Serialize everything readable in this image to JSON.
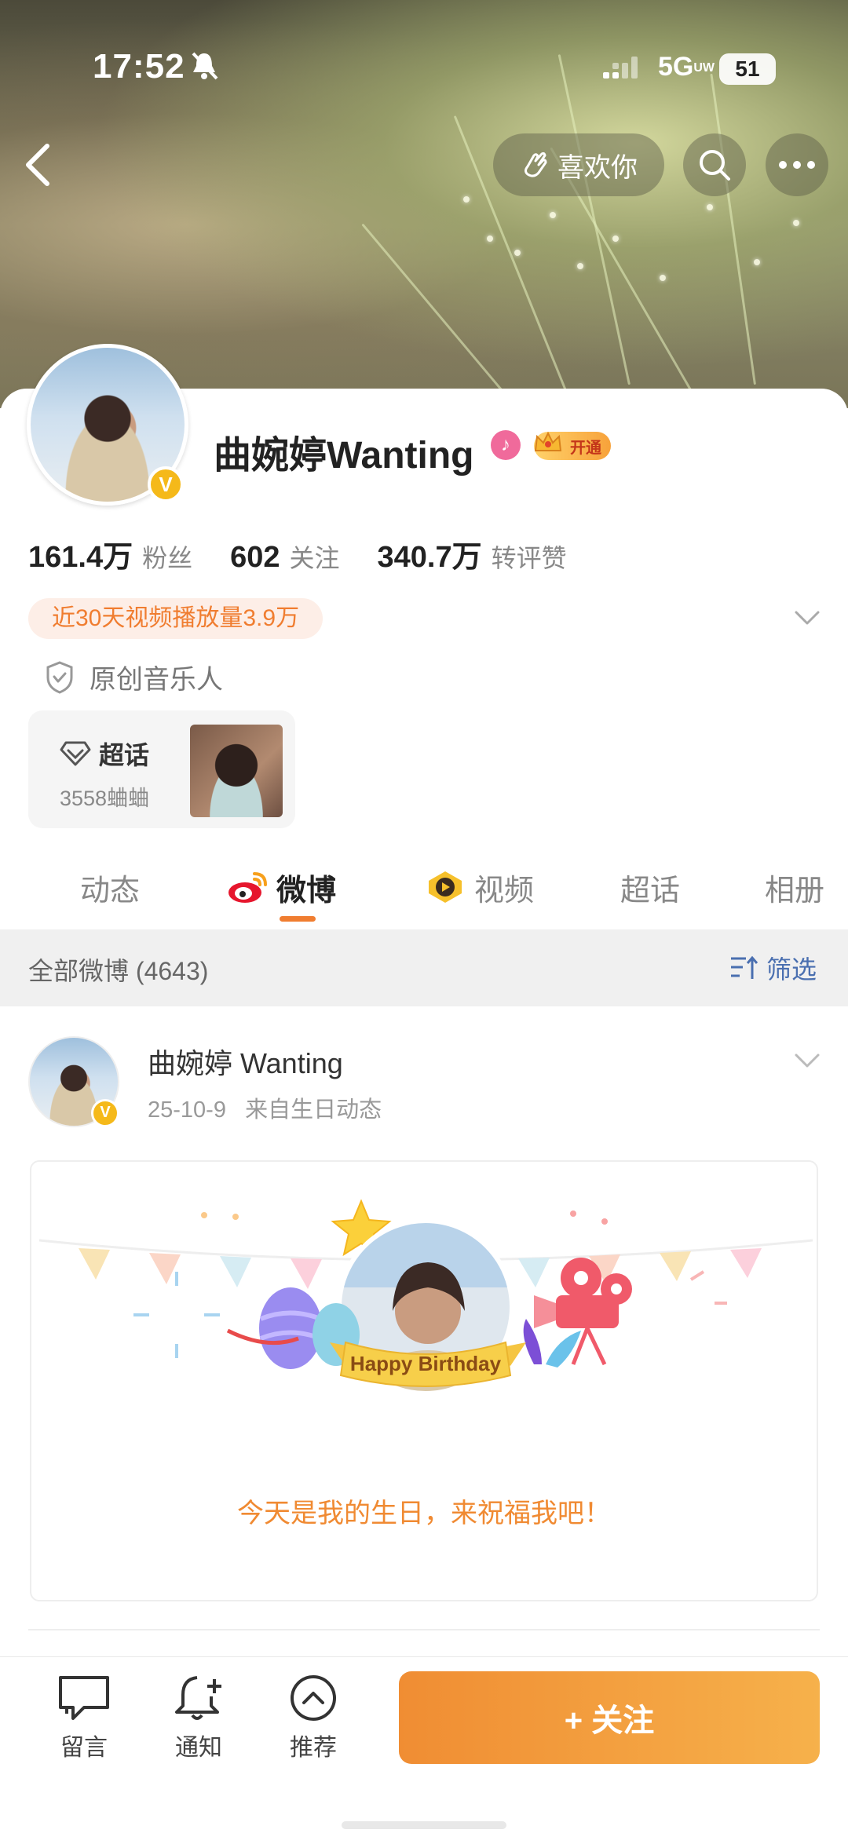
{
  "status_bar": {
    "time": "17:52",
    "network": "5G",
    "network_sub": "UW",
    "battery": "51"
  },
  "header": {
    "like_label": "喜欢你",
    "icons": [
      "back-icon",
      "clap-icon",
      "search-icon",
      "more-icon"
    ]
  },
  "profile": {
    "name": "曲婉婷Wanting",
    "vip_label": "开通",
    "stats": [
      {
        "num": "161.4万",
        "label": "粉丝"
      },
      {
        "num": "602",
        "label": "关注"
      },
      {
        "num": "340.7万",
        "label": "转评赞"
      }
    ],
    "play_tag": "近30天视频播放量3.9万",
    "role": "原创音乐人",
    "super_topic": {
      "title": "超话",
      "count": "3558蛐蛐"
    }
  },
  "tabs": [
    {
      "label": "动态"
    },
    {
      "label": "微博"
    },
    {
      "label": "视频"
    },
    {
      "label": "超话"
    },
    {
      "label": "相册"
    }
  ],
  "filter_bar": {
    "all_label": "全部微博",
    "count": "(4643)",
    "filter_label": "筛选"
  },
  "post": {
    "author": "曲婉婷 Wanting",
    "date": "25-10-9",
    "source": "来自生日动态",
    "banner_text": "Happy Birthday",
    "message": "今天是我的生日，来祝福我吧！"
  },
  "bottom_bar": {
    "message_label": "留言",
    "notify_label": "通知",
    "recommend_label": "推荐",
    "follow_label": "+ 关注"
  },
  "colors": {
    "accent": "#f07d30",
    "link_blue": "#4a6fb0",
    "verified": "#f5b91a"
  }
}
